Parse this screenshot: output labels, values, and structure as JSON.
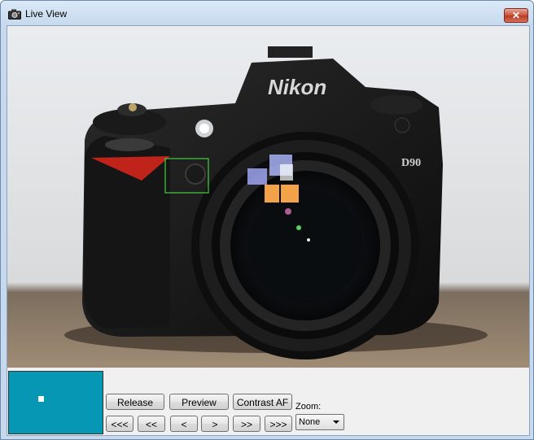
{
  "window": {
    "title": "Live View",
    "close_label": "✕"
  },
  "liveview": {
    "brand_text": "Nikon",
    "model_text": "D90",
    "focus_box_color": "#3fd13f"
  },
  "thumbnail": {
    "background_color": "#0697b4"
  },
  "buttons": {
    "release": "Release",
    "preview": "Preview",
    "contrast_af": "Contrast AF",
    "nav_far_left": "<<<",
    "nav_left2": "<<",
    "nav_left": "<",
    "nav_right": ">",
    "nav_right2": ">>",
    "nav_far_right": ">>>"
  },
  "zoom": {
    "label": "Zoom:",
    "selected": "None"
  },
  "icons": {
    "app": "camera-icon",
    "close": "close-icon",
    "dropdown": "chevron-down-icon"
  }
}
